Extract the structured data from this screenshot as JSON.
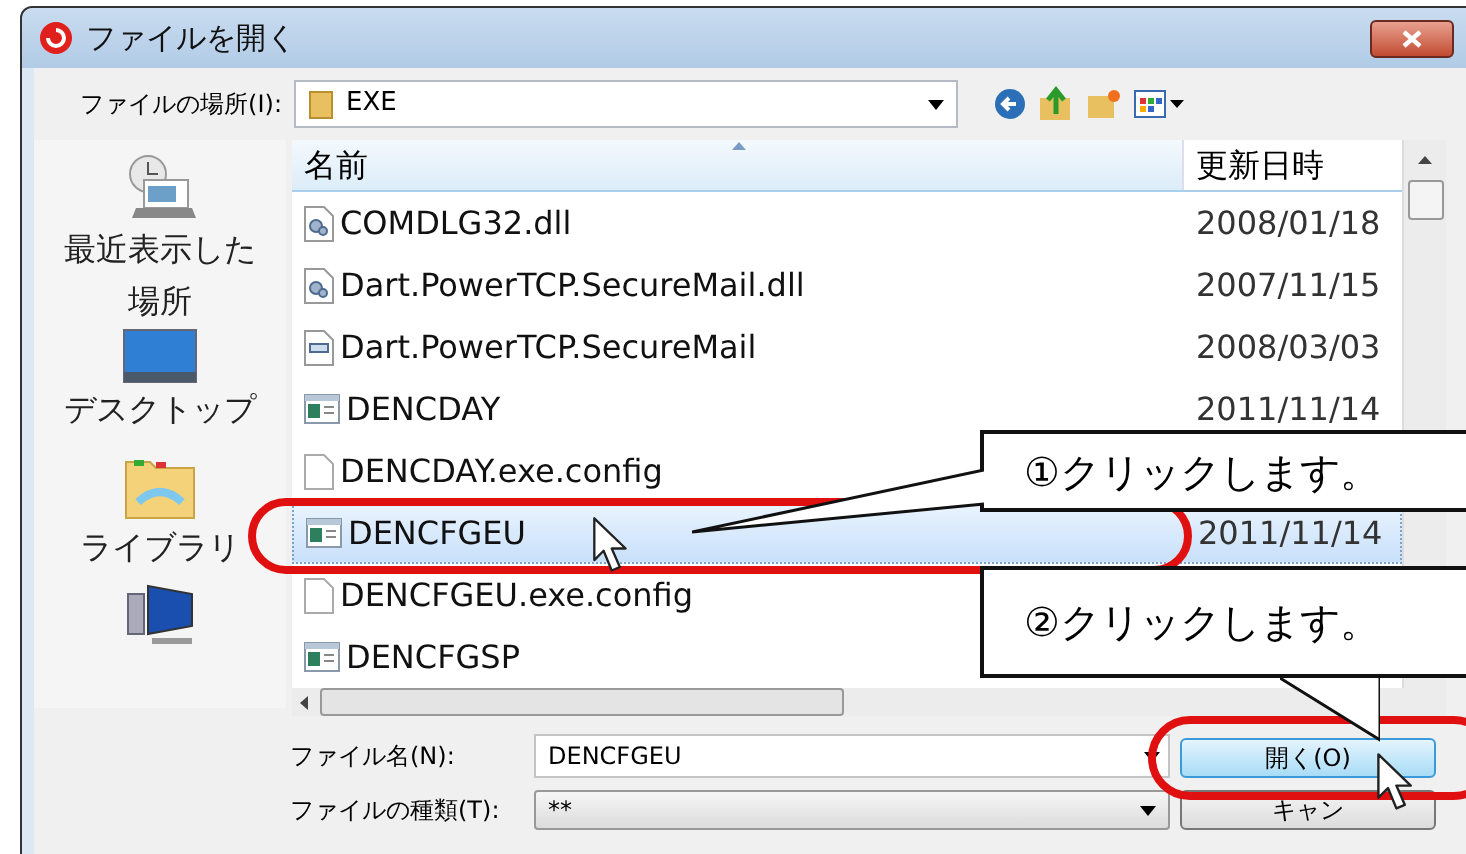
{
  "window": {
    "title": "ファイルを開く"
  },
  "location": {
    "label": "ファイルの場所(I):",
    "value": "EXE"
  },
  "sidebar": {
    "items": [
      {
        "label": "最近表示した場所",
        "kind": "recent"
      },
      {
        "label": "デスクトップ",
        "kind": "desktop"
      },
      {
        "label": "ライブラリ",
        "kind": "library"
      },
      {
        "kind": "computer"
      }
    ]
  },
  "table": {
    "columns": [
      "名前",
      "更新日時"
    ],
    "rows": [
      {
        "name": "COMDLG32.dll",
        "date": "2008/01/18",
        "kind": "dll",
        "selected": false
      },
      {
        "name": "Dart.PowerTCP.SecureMail.dll",
        "date": "2007/11/15",
        "kind": "dll",
        "selected": false
      },
      {
        "name": "Dart.PowerTCP.SecureMail",
        "date": "2008/03/03",
        "kind": "xml",
        "selected": false
      },
      {
        "name": "DENCDAY",
        "date": "2011/11/14",
        "kind": "app",
        "selected": false
      },
      {
        "name": "DENCDAY.exe.config",
        "kind": "file",
        "selected": false
      },
      {
        "name": "DENCFGEU",
        "date": "2011/11/14",
        "kind": "app",
        "selected": true
      },
      {
        "name": "DENCFGEU.exe.config",
        "kind": "file",
        "selected": false
      },
      {
        "name": "DENCFGSP",
        "kind": "app",
        "selected": false
      }
    ]
  },
  "filename": {
    "label": "ファイル名(N):",
    "value": "DENCFGEU"
  },
  "filetype": {
    "label": "ファイルの種類(T):",
    "value": "**"
  },
  "buttons": [
    {
      "label": "開く(O)",
      "kind": "primary"
    },
    {
      "label": "キャン",
      "kind": "secondary"
    }
  ],
  "callouts": [
    {
      "text": "①クリックします。"
    },
    {
      "text": "②クリックします。"
    }
  ]
}
